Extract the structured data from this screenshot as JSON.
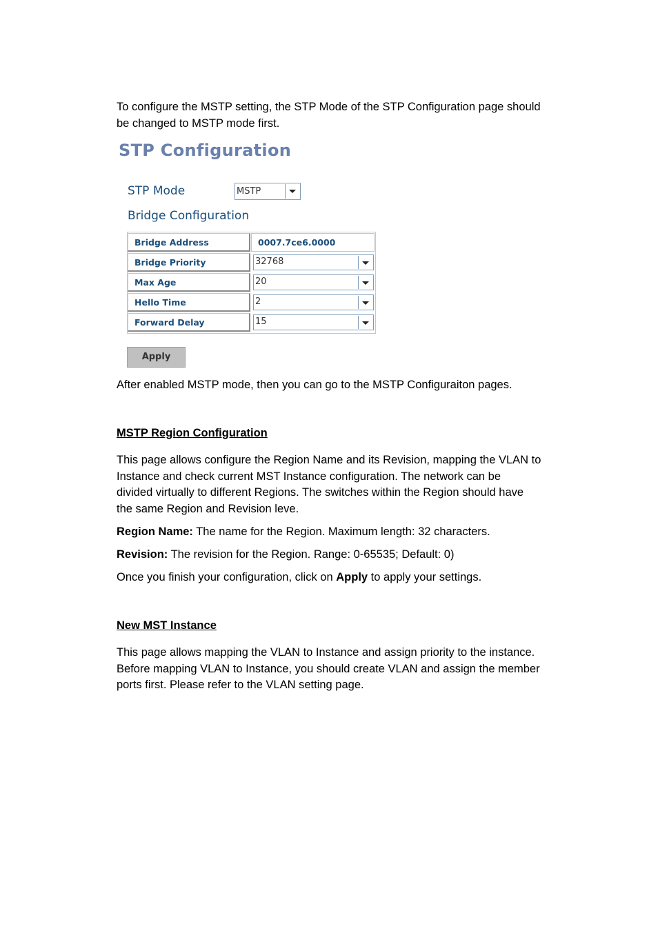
{
  "intro": {
    "line1": "To configure the MSTP setting, the STP Mode of the STP Configuration page should",
    "line2": "be changed to MSTP mode first."
  },
  "stp_config": {
    "title": "STP Configuration",
    "stp_mode_label": "STP Mode",
    "stp_mode_value": "MSTP",
    "bridge_section_title": "Bridge Configuration",
    "rows": [
      {
        "label": "Bridge Address",
        "value": "0007.7ce6.0000"
      },
      {
        "label": "Bridge Priority",
        "value": "32768"
      },
      {
        "label": "Max Age",
        "value": "20"
      },
      {
        "label": "Hello Time",
        "value": "2"
      },
      {
        "label": "Forward Delay",
        "value": "15"
      }
    ],
    "apply_label": "Apply",
    "icons": {
      "dropdown": "chevron-down-icon"
    }
  },
  "after_text": "After enabled MSTP mode, then you can go to the MSTP Configuraiton pages.",
  "region_section": {
    "heading": "MSTP Region Configuration",
    "para_lines": [
      "This page allows configure the Region Name and its Revision, mapping the VLAN to",
      "Instance and check current MST Instance configuration. The network can be",
      "divided virtually to different Regions. The switches within the Region should have",
      "the same Region and Revision leve."
    ],
    "region_name_label": "Region Name:",
    "region_name_desc": " The name for the Region. Maximum length: 32 characters.",
    "revision_label": "Revision:",
    "revision_desc": " The revision for the Region. Range: 0-65535; Default: 0)",
    "finish_pre": "Once you finish your configuration, click on ",
    "finish_bold": "Apply",
    "finish_post": " to apply your settings."
  },
  "instance_section": {
    "heading": "New MST Instance",
    "para_lines": [
      "This page allows mapping the VLAN to Instance and assign priority to the instance.",
      "Before mapping VLAN to Instance, you should create VLAN and assign the member",
      "ports first. Please refer to the VLAN setting page."
    ]
  }
}
